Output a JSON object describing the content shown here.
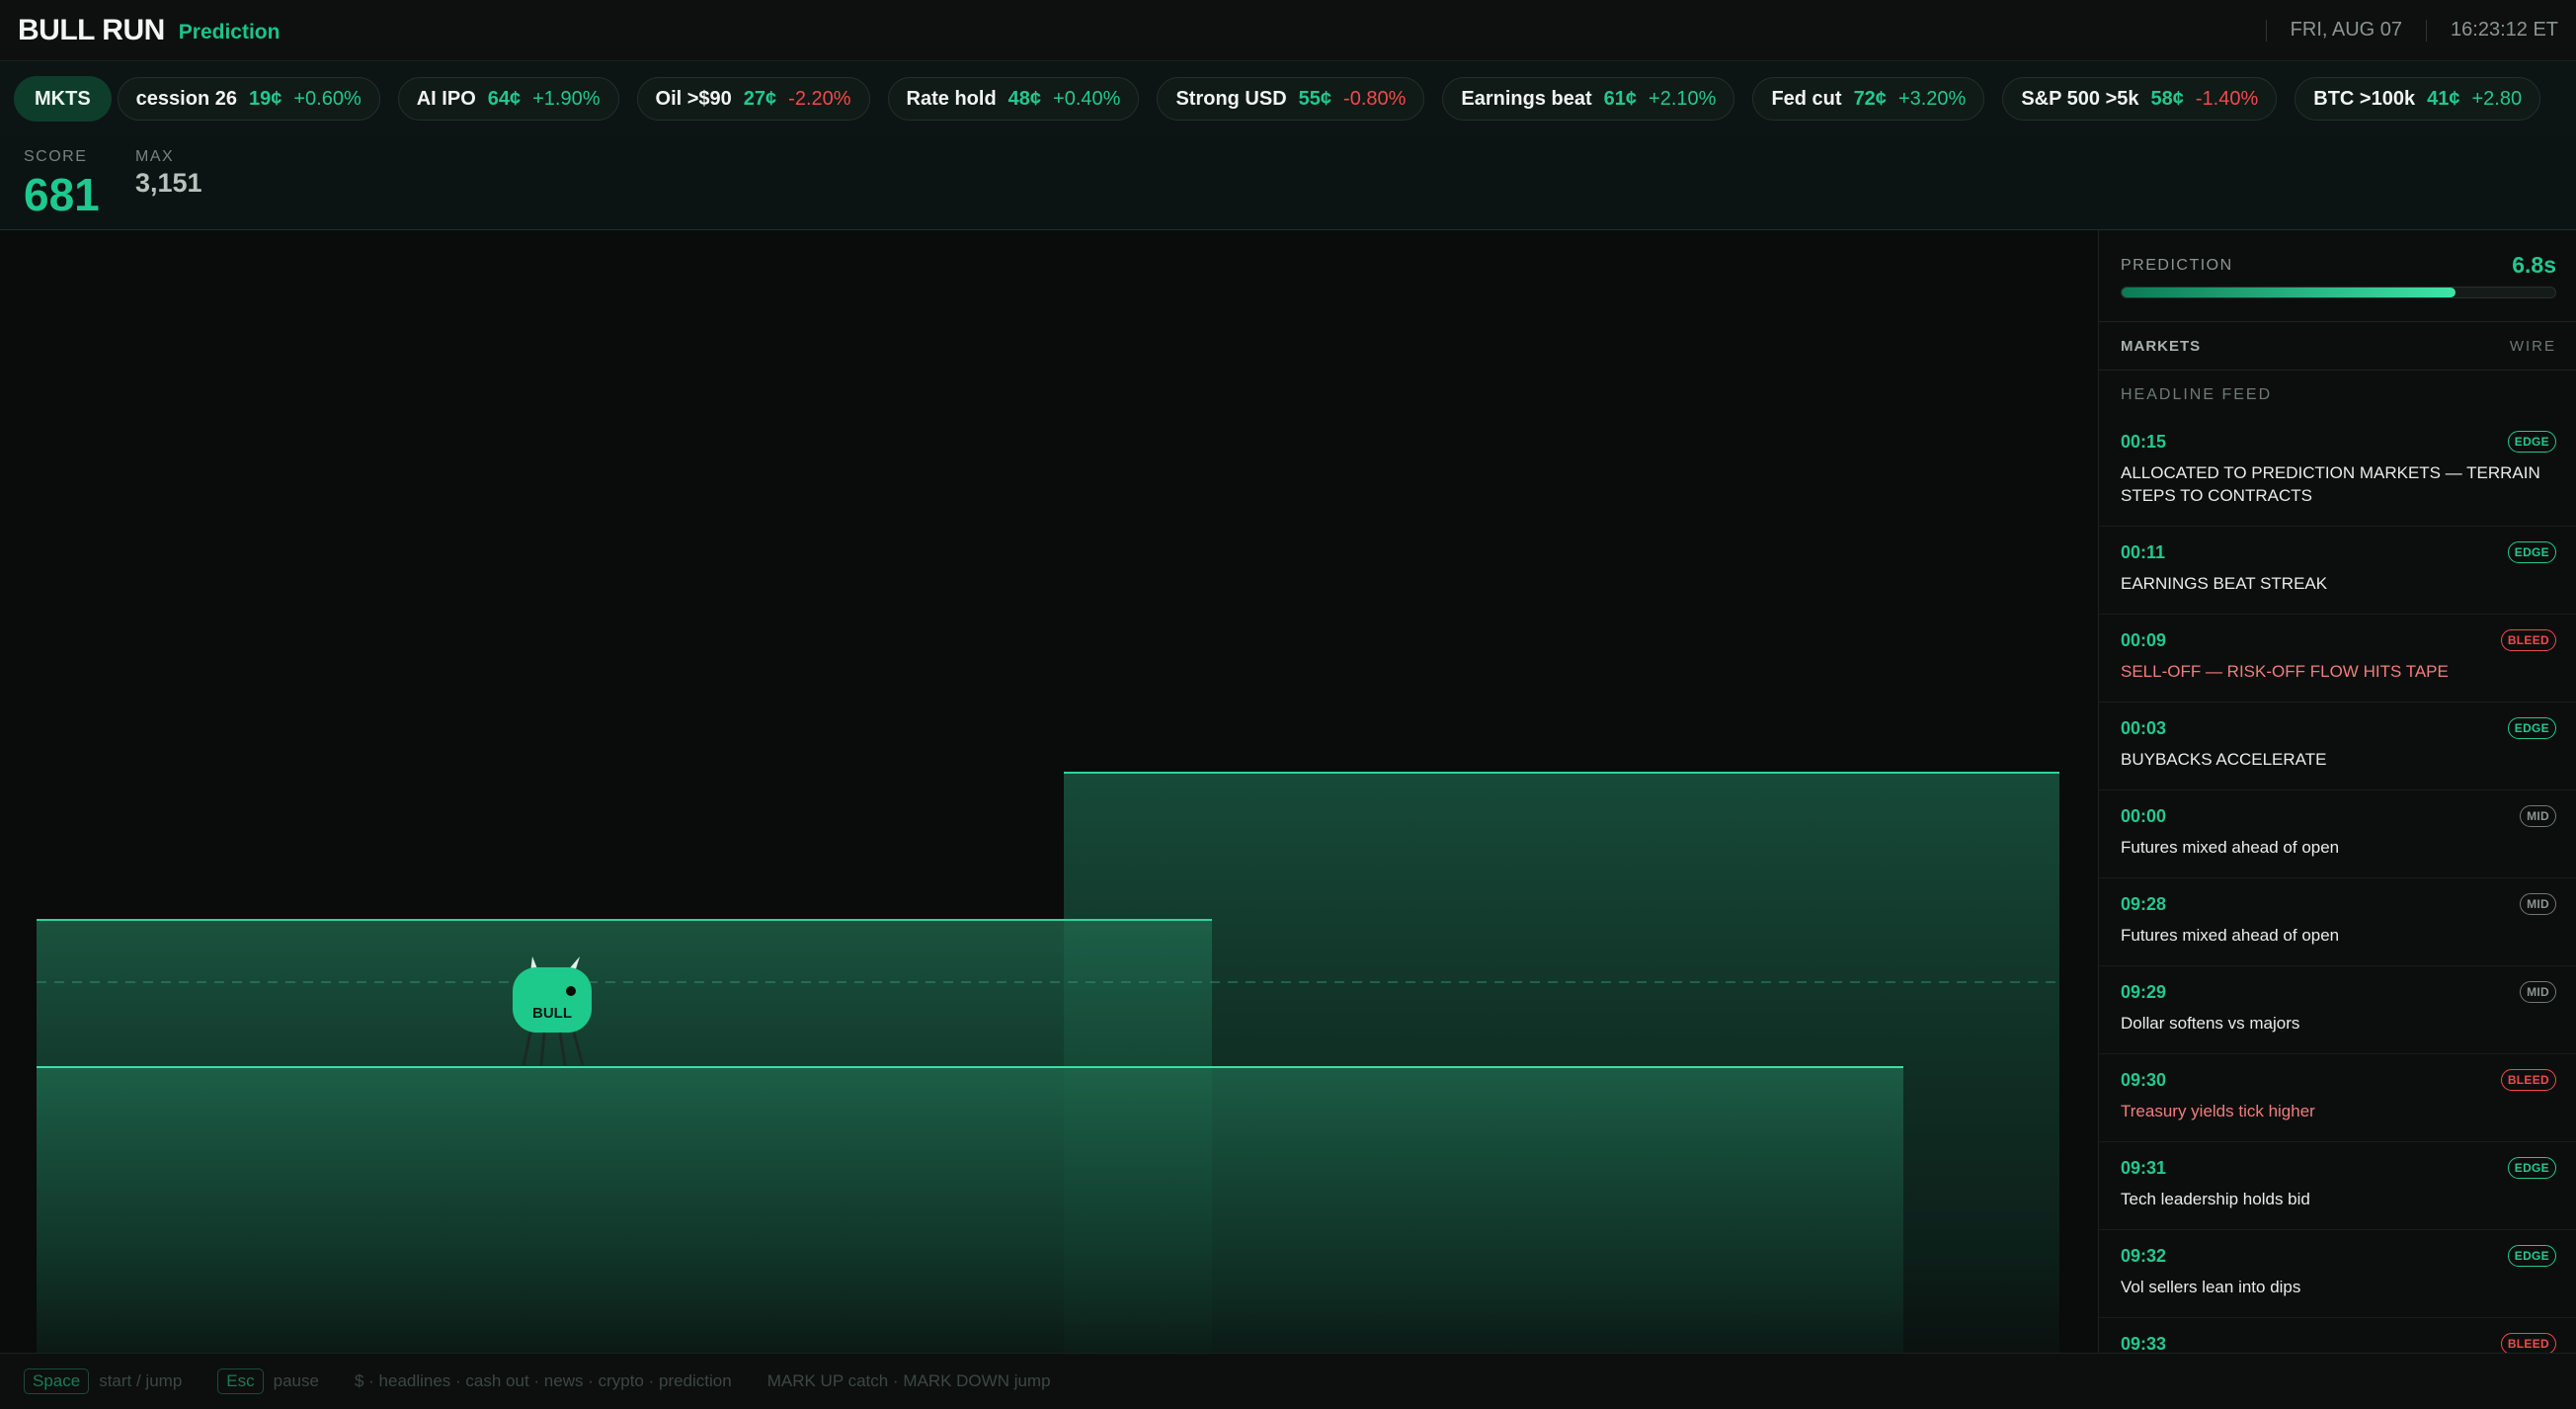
{
  "app": {
    "title": "BULL RUN",
    "mode": "Prediction"
  },
  "header": {
    "date": "FRI, AUG 07",
    "time": "16:23:12 ET"
  },
  "ticker": {
    "mkts_label": "MKTS",
    "items": [
      {
        "name": "cession 26",
        "price": "19¢",
        "change": "+0.60%",
        "dir": "up"
      },
      {
        "name": "AI IPO",
        "price": "64¢",
        "change": "+1.90%",
        "dir": "up"
      },
      {
        "name": "Oil >$90",
        "price": "27¢",
        "change": "-2.20%",
        "dir": "down"
      },
      {
        "name": "Rate hold",
        "price": "48¢",
        "change": "+0.40%",
        "dir": "up"
      },
      {
        "name": "Strong USD",
        "price": "55¢",
        "change": "-0.80%",
        "dir": "down"
      },
      {
        "name": "Earnings beat",
        "price": "61¢",
        "change": "+2.10%",
        "dir": "up"
      },
      {
        "name": "Fed cut",
        "price": "72¢",
        "change": "+3.20%",
        "dir": "up"
      },
      {
        "name": "S&P 500 >5k",
        "price": "58¢",
        "change": "-1.40%",
        "dir": "down"
      },
      {
        "name": "BTC >100k",
        "price": "41¢",
        "change": "+2.80",
        "dir": "up"
      }
    ]
  },
  "score": {
    "score_label": "SCORE",
    "score": "681",
    "max_label": "MAX",
    "max": "3,151"
  },
  "game": {
    "player_label": "BULL"
  },
  "panel": {
    "prediction_label": "PREDICTION",
    "prediction_time": "6.8s",
    "prediction_progress": 0.77,
    "tab_markets": "MARKETS",
    "tab_wire": "WIRE",
    "feed_title": "HEADLINE FEED",
    "feed": [
      {
        "time": "00:15",
        "badge": "EDGE",
        "kind": "edge",
        "headline": "ALLOCATED TO PREDICTION MARKETS — TERRAIN STEPS TO CONTRACTS"
      },
      {
        "time": "00:11",
        "badge": "EDGE",
        "kind": "edge",
        "headline": "EARNINGS BEAT STREAK"
      },
      {
        "time": "00:09",
        "badge": "BLEED",
        "kind": "bleed",
        "headline": "SELL-OFF — RISK-OFF FLOW HITS TAPE"
      },
      {
        "time": "00:03",
        "badge": "EDGE",
        "kind": "edge",
        "headline": "BUYBACKS ACCELERATE"
      },
      {
        "time": "00:00",
        "badge": "MID",
        "kind": "mid",
        "headline": "Futures mixed ahead of open"
      },
      {
        "time": "09:28",
        "badge": "MID",
        "kind": "mid",
        "headline": "Futures mixed ahead of open"
      },
      {
        "time": "09:29",
        "badge": "MID",
        "kind": "mid",
        "headline": "Dollar softens vs majors"
      },
      {
        "time": "09:30",
        "badge": "BLEED",
        "kind": "bleed",
        "headline": "Treasury yields tick higher"
      },
      {
        "time": "09:31",
        "badge": "EDGE",
        "kind": "edge",
        "headline": "Tech leadership holds bid"
      },
      {
        "time": "09:32",
        "badge": "EDGE",
        "kind": "edge",
        "headline": "Vol sellers lean into dips"
      },
      {
        "time": "09:33",
        "badge": "BLEED",
        "kind": "bleed",
        "headline": ""
      }
    ]
  },
  "footer": {
    "space_key": "Space",
    "space_hint": "start / jump",
    "esc_key": "Esc",
    "esc_hint": "pause",
    "modes_hint": "$ · headlines · cash out · news · crypto · prediction",
    "mark_hint": "MARK UP catch · MARK DOWN jump"
  },
  "colors": {
    "accent": "#22c98f",
    "bleed": "#f04a4a",
    "background": "#0b0c0c"
  }
}
